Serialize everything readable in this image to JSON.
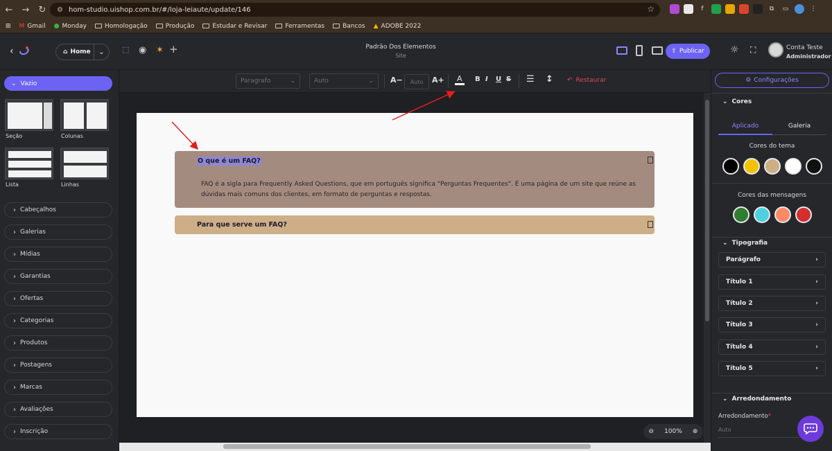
{
  "browser": {
    "url": "hom-studio.uishop.com.br/#/loja-leiaute/update/146",
    "bookmarks": [
      "Gmail",
      "Monday",
      "Homologação",
      "Produção",
      "Estudar e Revisar",
      "Ferramentas",
      "Bancos",
      "ADOBE 2022"
    ]
  },
  "header": {
    "home_label": "Home",
    "page_title": "Padrão Dos Elementos",
    "page_subtitle": "Site",
    "publish_label": "Publicar",
    "user_name": "Conta Teste",
    "user_role": "Administrador"
  },
  "sidebar": {
    "vazio_label": "Vazio",
    "tiles": [
      {
        "label": "Seção"
      },
      {
        "label": "Colunas"
      },
      {
        "label": "Lista"
      },
      {
        "label": "Linhas"
      }
    ],
    "items": [
      {
        "label": "Cabeçalhos"
      },
      {
        "label": "Galerias"
      },
      {
        "label": "Mídias"
      },
      {
        "label": "Garantias"
      },
      {
        "label": "Ofertas"
      },
      {
        "label": "Categorias"
      },
      {
        "label": "Produtos"
      },
      {
        "label": "Postagens"
      },
      {
        "label": "Marcas"
      },
      {
        "label": "Avaliações"
      },
      {
        "label": "Inscrição"
      }
    ]
  },
  "toolbar": {
    "paragraph_select": "Paragrafo",
    "font_select": "Auto",
    "decrease_label": "A−",
    "size_placeholder": "Auto",
    "increase_label": "A+",
    "color_label": "A",
    "bold_label": "B",
    "italic_label": "I",
    "underline_label": "U",
    "strike_label": "S",
    "restore_label": "Restaurar"
  },
  "canvas": {
    "faq": [
      {
        "question": "O que é um FAQ?",
        "answer": "FAQ é a sigla para Frequently Asked Questions, que em português significa \"Perguntas Frequentes\". É uma página de um site que reúne as dúvidas mais comuns dos clientes, em formato de perguntas e respostas."
      },
      {
        "question": "Para que serve um FAQ?"
      }
    ],
    "zoom_level": "100%"
  },
  "right_panel": {
    "config_label": "Configurações",
    "cores_title": "Cores",
    "tab_applied": "Aplicado",
    "tab_gallery": "Galeria",
    "theme_colors_label": "Cores do tema",
    "theme_colors": [
      "#000000",
      "#f2c200",
      "#cdae86",
      "#ffffff",
      "#111111"
    ],
    "message_colors_label": "Cores das mensagens",
    "message_colors": [
      "#2e7d32",
      "#4dd0e1",
      "#ff8a65",
      "#d32f2f"
    ],
    "typography_title": "Tipografia",
    "typography_items": [
      {
        "label": "Parágrafo"
      },
      {
        "label": "Título 1"
      },
      {
        "label": "Título 2"
      },
      {
        "label": "Título 3"
      },
      {
        "label": "Título 4"
      },
      {
        "label": "Título 5"
      }
    ],
    "rounding_title": "Arredondamento",
    "rounding_label": "Arredondamento",
    "rounding_required": "*",
    "rounding_placeholder": "Auto"
  },
  "colors": {
    "accent": "#6c63f5",
    "faq_open_bg": "#a48b7f",
    "faq_closed_bg": "#cdae86",
    "danger": "#e0445a"
  }
}
